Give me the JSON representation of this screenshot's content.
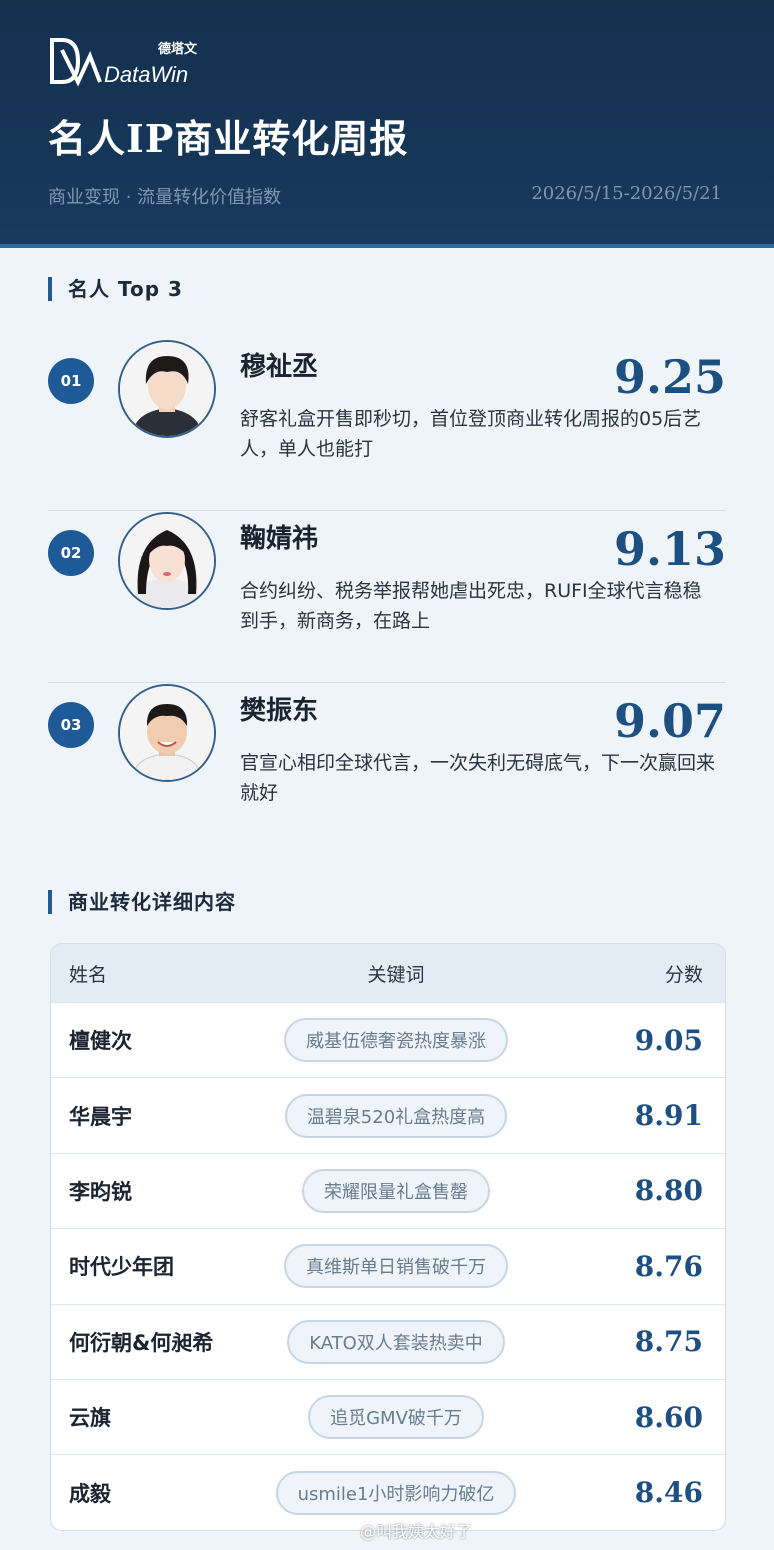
{
  "header": {
    "logo_small": "德塔文",
    "logo_text": "DataWin",
    "title": "名人IP商业转化周报",
    "subtitle": "商业变现 · 流量转化价值指数",
    "date_range": "2026/5/15-2026/5/21"
  },
  "top3": {
    "title": "名人 Top 3",
    "items": [
      {
        "rank": "01",
        "name": "穆祉丞",
        "score": "9.25",
        "desc": "舒客礼盒开售即秒切，首位登顶商业转化周报的05后艺人，单人也能打"
      },
      {
        "rank": "02",
        "name": "鞠婧祎",
        "score": "9.13",
        "desc": "合约纠纷、税务举报帮她虐出死忠，RUFI全球代言稳稳到手，新商务，在路上"
      },
      {
        "rank": "03",
        "name": "樊振东",
        "score": "9.07",
        "desc": "官宣心相印全球代言，一次失利无碍底气，下一次赢回来就好"
      }
    ]
  },
  "details": {
    "title": "商业转化详细内容",
    "headers": {
      "name": "姓名",
      "keyword": "关键词",
      "score": "分数"
    },
    "rows": [
      {
        "name": "檀健次",
        "keyword": "威基伍德奢瓷热度暴涨",
        "score": "9.05"
      },
      {
        "name": "华晨宇",
        "keyword": "温碧泉520礼盒热度高",
        "score": "8.91"
      },
      {
        "name": "李昀锐",
        "keyword": "荣耀限量礼盒售罄",
        "score": "8.80"
      },
      {
        "name": "时代少年团",
        "keyword": "真维斯单日销售破千万",
        "score": "8.76"
      },
      {
        "name": "何衍朝&何昶希",
        "keyword": "KATO双人套装热卖中",
        "score": "8.75"
      },
      {
        "name": "云旗",
        "keyword": "追觅GMV破千万",
        "score": "8.60"
      },
      {
        "name": "成毅",
        "keyword": "usmile1小时影响力破亿",
        "score": "8.46"
      }
    ]
  },
  "watermark": "@叫我姨太好了",
  "colors": {
    "header_bg": "#13304f",
    "accent": "#1d5a97",
    "score": "#1d4f80"
  }
}
